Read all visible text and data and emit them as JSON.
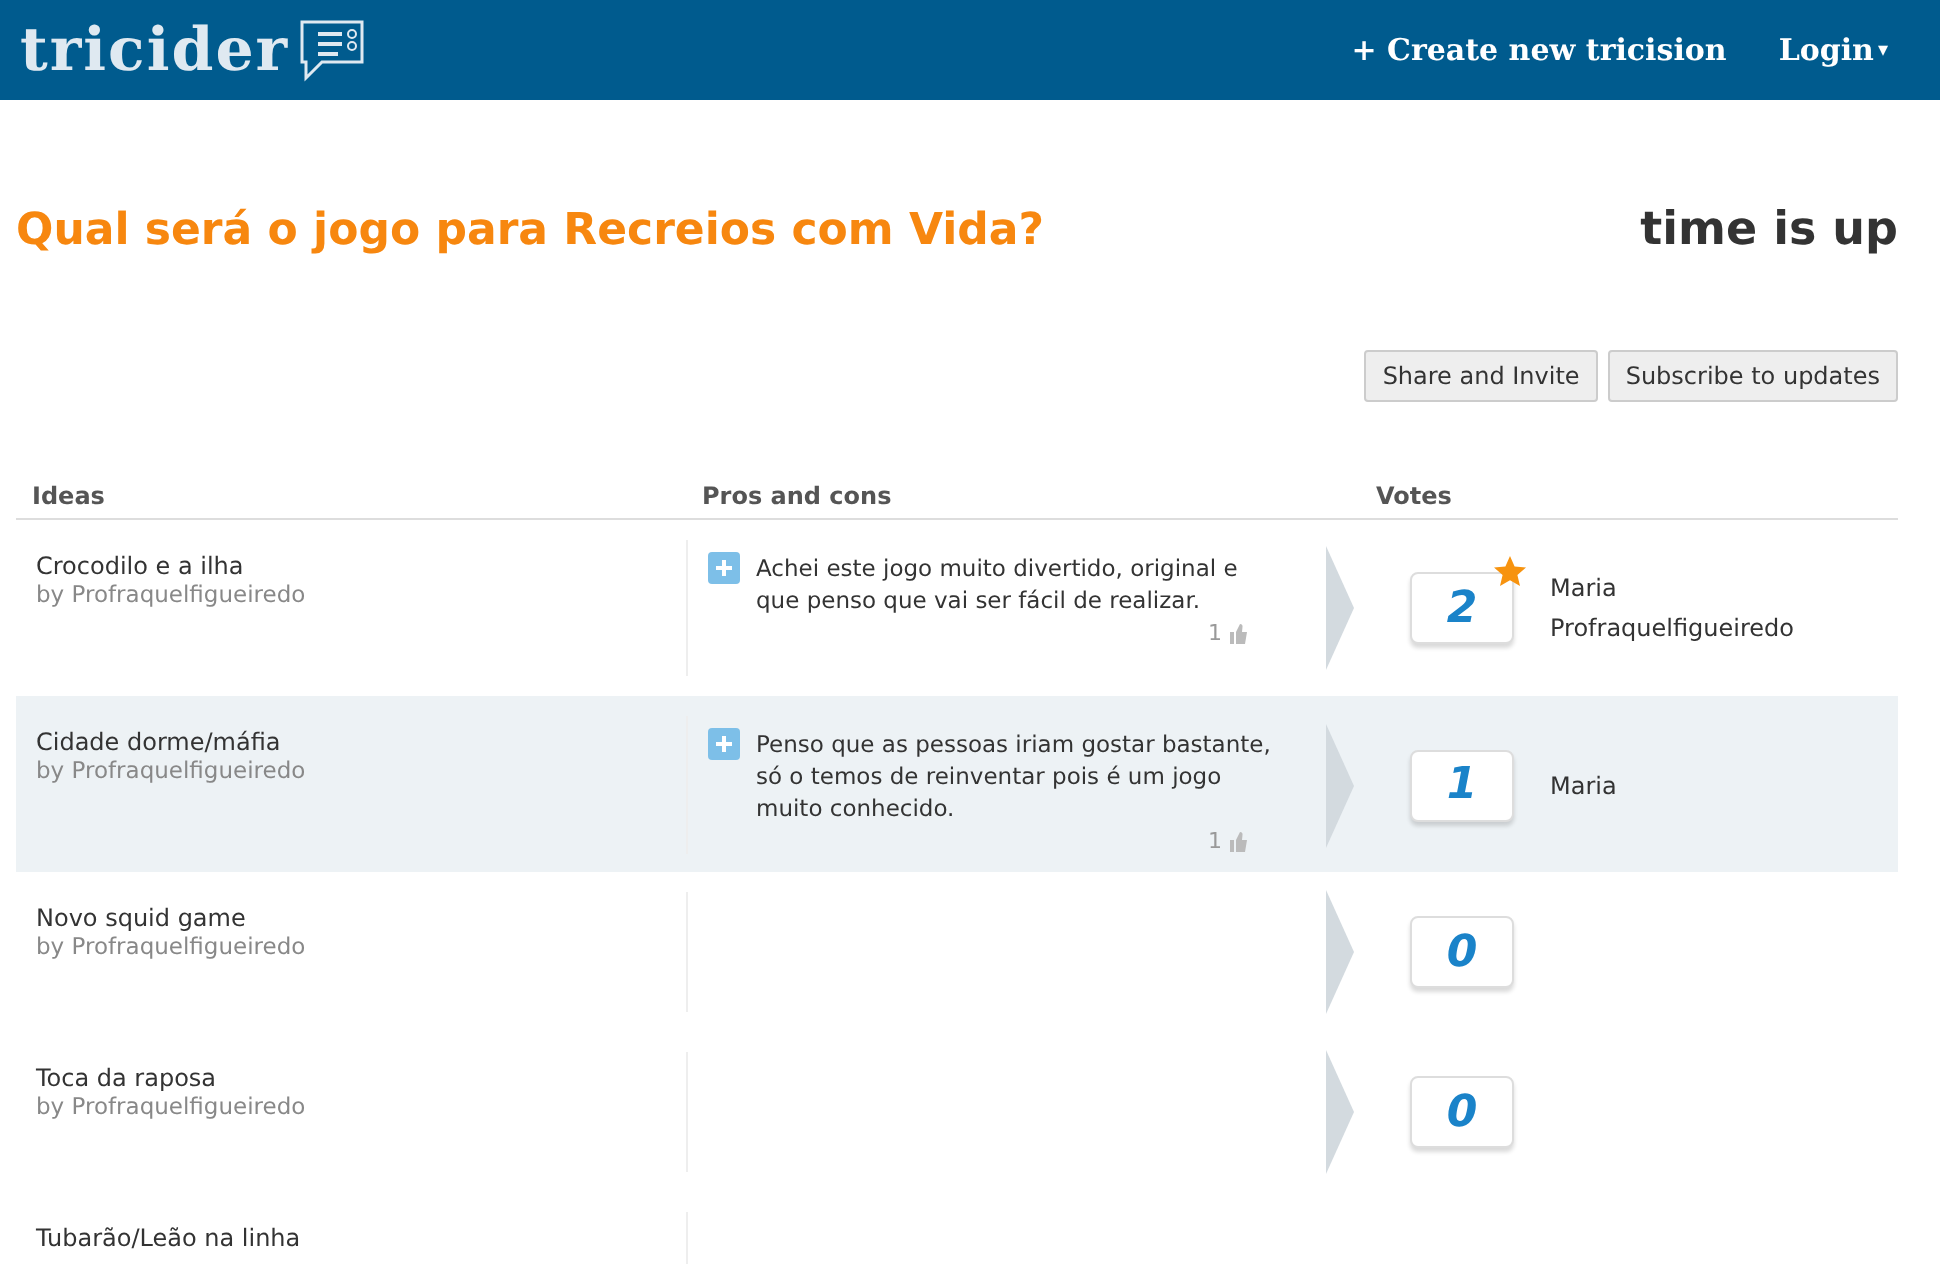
{
  "header": {
    "logo": "tricider",
    "create_link": "+ Create new tricision",
    "login": "Login",
    "login_caret": "▾"
  },
  "title": "Qual será o jogo para Recreios com Vida?",
  "status": "time is up",
  "buttons": [
    "Share and Invite",
    "Subscribe to updates"
  ],
  "table": {
    "columns": [
      "Ideas",
      "Pros and cons",
      "Votes"
    ],
    "rows": [
      {
        "idea": "Crocodilo e a ilha",
        "author": "by Profraquelfigueiredo",
        "highlighted": false,
        "arguments": [
          {
            "text": "Achei este jogo muito divertido, original e que penso que vai ser fácil de realizar.",
            "likes": "1"
          }
        ],
        "votes": "2",
        "winner": true,
        "voters": [
          "Maria",
          "Profraquelfigueiredo"
        ]
      },
      {
        "idea": "Cidade dorme/máfia",
        "author": "by Profraquelfigueiredo",
        "highlighted": true,
        "arguments": [
          {
            "text": "Penso que as pessoas iriam gostar bastante, só o temos de reinventar pois é um jogo muito conhecido.",
            "likes": "1"
          }
        ],
        "votes": "1",
        "winner": false,
        "voters": [
          "Maria"
        ]
      },
      {
        "idea": "Novo squid game",
        "author": "by Profraquelfigueiredo",
        "highlighted": false,
        "arguments": [],
        "votes": "0",
        "winner": false,
        "voters": []
      },
      {
        "idea": "Toca da raposa",
        "author": "by Profraquelfigueiredo",
        "highlighted": false,
        "arguments": [],
        "votes": "0",
        "winner": false,
        "voters": []
      },
      {
        "idea": "Tubarão/Leão na linha",
        "highlighted": false
      }
    ]
  }
}
